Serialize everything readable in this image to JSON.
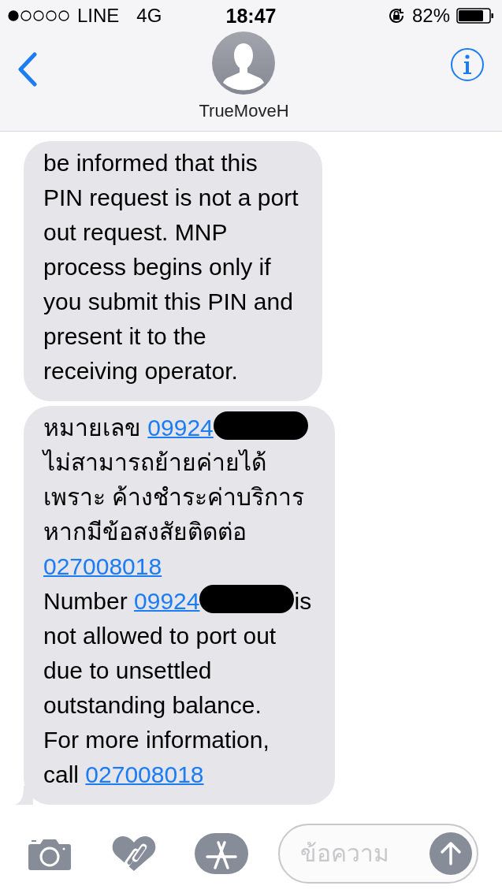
{
  "status_bar": {
    "carrier": "LINE",
    "network": "4G",
    "time": "18:47",
    "battery": "82%"
  },
  "header": {
    "contact": "TrueMoveH"
  },
  "messages": [
    {
      "lines": [
        [
          {
            "kind": "text",
            "text": "be informed that this"
          }
        ],
        [
          {
            "kind": "text",
            "text": "PIN request is not a port"
          }
        ],
        [
          {
            "kind": "text",
            "text": "out request. MNP"
          }
        ],
        [
          {
            "kind": "text",
            "text": "process begins only if"
          }
        ],
        [
          {
            "kind": "text",
            "text": "you submit this PIN and"
          }
        ],
        [
          {
            "kind": "text",
            "text": "present it to the"
          }
        ],
        [
          {
            "kind": "text",
            "text": "receiving operator."
          }
        ]
      ]
    },
    {
      "lines": [
        [
          {
            "kind": "text",
            "text": "หมายเลข "
          },
          {
            "kind": "link",
            "text": "09924"
          },
          {
            "kind": "redaction"
          }
        ],
        [
          {
            "kind": "text",
            "text": "ไม่สามารถย้ายค่ายได้"
          }
        ],
        [
          {
            "kind": "text",
            "text": "เพราะ ค้างชำระค่าบริการ"
          }
        ],
        [
          {
            "kind": "text",
            "text": "หากมีข้อสงสัยติดต่อ"
          }
        ],
        [
          {
            "kind": "link",
            "text": "027008018"
          }
        ],
        [
          {
            "kind": "text",
            "text": "Number "
          },
          {
            "kind": "link",
            "text": "09924"
          },
          {
            "kind": "redaction"
          },
          {
            "kind": "text",
            "text": "is"
          }
        ],
        [
          {
            "kind": "text",
            "text": "not allowed to port out"
          }
        ],
        [
          {
            "kind": "text",
            "text": "due to unsettled"
          }
        ],
        [
          {
            "kind": "text",
            "text": "outstanding balance."
          }
        ],
        [
          {
            "kind": "text",
            "text": "For more information,"
          }
        ],
        [
          {
            "kind": "text",
            "text": "call "
          },
          {
            "kind": "link",
            "text": "027008018"
          }
        ]
      ]
    }
  ],
  "composer": {
    "placeholder": "ข้อความ"
  }
}
